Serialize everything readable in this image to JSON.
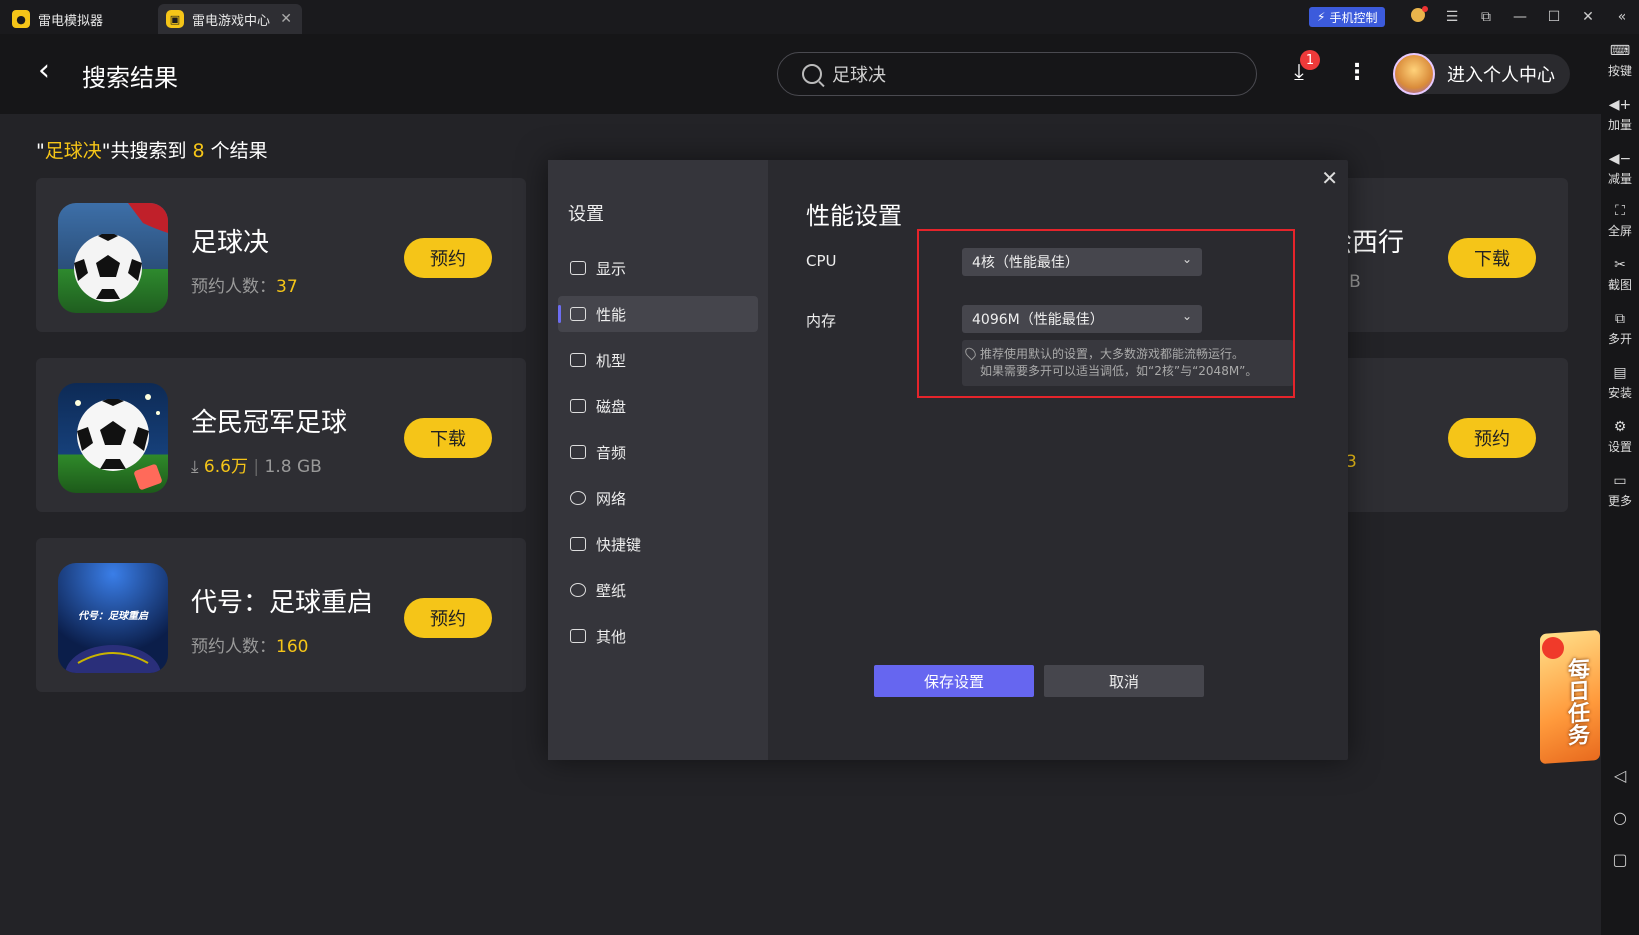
{
  "titlebar": {
    "tab1_label": "雷电模拟器",
    "tab2_label": "雷电游戏中心",
    "phone_control_label": "手机控制"
  },
  "header": {
    "title": "搜索结果",
    "search_value": "足球决",
    "download_badge": "1",
    "profile_label": "进入个人中心"
  },
  "results": {
    "open_quote": "\"",
    "keyword": "足球决",
    "mid_text": "\"共搜索到 ",
    "count": "8",
    "tail_text": " 个结果"
  },
  "cards": [
    {
      "name": "足球决",
      "meta_label": "预约人数：",
      "meta_value": "37",
      "button": "预约"
    },
    {
      "name": "全民冠军足球",
      "meta_value": "6.6万",
      "meta_size": "1.8 GB",
      "button": "下载"
    },
    {
      "name": "代号：足球重启",
      "meta_label": "预约人数：",
      "meta_value": "160",
      "button": "预约",
      "icon_text": "代号：足球重启"
    }
  ],
  "right_cards": [
    {
      "name_tail": "绘西行",
      "meta_tail": "GB",
      "button": "下载"
    },
    {
      "meta_tail": "3",
      "button": "预约"
    }
  ],
  "sidebar": [
    {
      "label": "按键",
      "icon": "keyboard-icon"
    },
    {
      "label": "加量",
      "icon": "volume-up-icon"
    },
    {
      "label": "减量",
      "icon": "volume-down-icon"
    },
    {
      "label": "全屏",
      "icon": "fullscreen-icon"
    },
    {
      "label": "截图",
      "icon": "scissors-icon"
    },
    {
      "label": "多开",
      "icon": "multi-instance-icon"
    },
    {
      "label": "安装",
      "icon": "apk-icon"
    },
    {
      "label": "设置",
      "icon": "gear-icon"
    },
    {
      "label": "更多",
      "icon": "more-icon"
    }
  ],
  "daily_task": "每日任务",
  "modal": {
    "side_title": "设置",
    "menu": [
      "显示",
      "性能",
      "机型",
      "磁盘",
      "音频",
      "网络",
      "快捷键",
      "壁纸",
      "其他"
    ],
    "active_index": 1,
    "title": "性能设置",
    "cpu_label": "CPU",
    "cpu_value": "4核（性能最佳）",
    "mem_label": "内存",
    "mem_value": "4096M（性能最佳）",
    "tip_line1": "推荐使用默认的设置，大多数游戏都能流畅运行。",
    "tip_line2": "如果需要多开可以适当调低，如“2核”与“2048M”。",
    "save_label": "保存设置",
    "cancel_label": "取消"
  },
  "colors": {
    "accent": "#f5c518",
    "primary_button": "#6666f0",
    "highlight_box": "#e5242b"
  }
}
